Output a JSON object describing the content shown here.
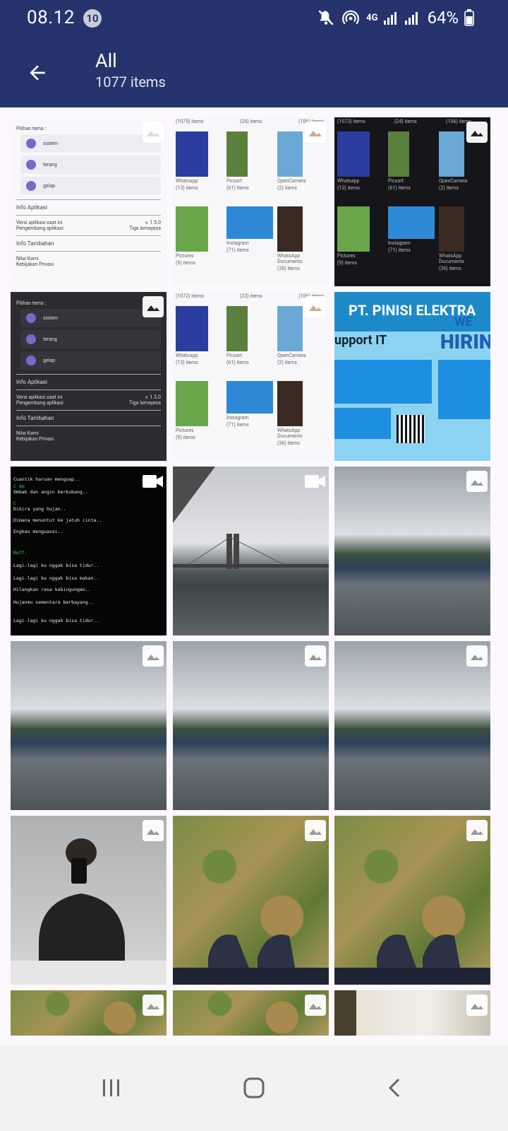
{
  "status_bar": {
    "time": "08.12",
    "notification_count": "10",
    "network": "4G",
    "battery": "64%"
  },
  "app_bar": {
    "title": "All",
    "subtitle": "1077 items"
  },
  "tiles": [
    {
      "type": "screenshot",
      "media": "image-icon"
    },
    {
      "type": "screenshot",
      "media": "image-icon"
    },
    {
      "type": "screenshot",
      "media": "image-icon"
    },
    {
      "type": "screenshot",
      "media": "image-icon"
    },
    {
      "type": "screenshot",
      "media": "image-icon"
    },
    {
      "type": "screenshot",
      "media": "image-icon"
    },
    {
      "type": "video",
      "media": "video-icon"
    },
    {
      "type": "video",
      "media": "video-icon"
    },
    {
      "type": "photo",
      "media": "image-icon"
    },
    {
      "type": "photo",
      "media": "image-icon"
    },
    {
      "type": "photo",
      "media": "image-icon"
    },
    {
      "type": "photo",
      "media": "image-icon"
    },
    {
      "type": "photo",
      "media": "image-icon"
    },
    {
      "type": "photo",
      "media": "image-icon"
    },
    {
      "type": "photo",
      "media": "image-icon"
    },
    {
      "type": "photo",
      "media": "image-icon"
    },
    {
      "type": "photo",
      "media": "image-icon"
    },
    {
      "type": "photo",
      "media": "image-icon"
    }
  ],
  "settings_screen": {
    "theme_heading": "Pilihan tema :",
    "theme_options": [
      "sistem",
      "terang",
      "gelap"
    ],
    "info_app_heading": "Info Aplikasi",
    "version_label": "Versi aplikasi saat ini",
    "version_value": "v. 1.5.0",
    "developer_label": "Pengembang aplikasi",
    "developer_value": "Tiga lamayeza",
    "extra_heading": "Info Tambahan",
    "extra_items": [
      "Nilai Kami",
      "Kebijakan Privasi"
    ]
  },
  "folders_screen_light": {
    "top": [
      "(1075) items",
      "(26) items",
      "(106) items"
    ],
    "folders": [
      {
        "name": "Whatsapp",
        "count": "(13) items"
      },
      {
        "name": "Picsart",
        "count": "(61) items"
      },
      {
        "name": "OpenCamera",
        "count": "(2) items"
      },
      {
        "name": "Pictures",
        "count": "(9) items"
      },
      {
        "name": "Instagram",
        "count": "(71) items"
      },
      {
        "name": "WhatsApp Documents",
        "count": "(36) items"
      }
    ]
  },
  "folders_screen_dark": {
    "top": [
      "(1073) items",
      "(24) items",
      "(106) items"
    ]
  },
  "folders_screen_light2": {
    "top": [
      "(1072) items",
      "(23) items",
      "(106) items"
    ]
  },
  "poster": {
    "company": "PT. PINISI ELEKTRA",
    "we": "WE",
    "hiring": "HIRING",
    "support": "upport IT"
  },
  "terminal_lines": [
    "Cuantik haruan menguap..",
    "Ombak dan angin berkubang..",
    "Dikira yang hujan..",
    "Dimana menuntut ke jatuh cinta..",
    "Engkau menguasai..",
    "Lagi-lagi ku nggak bisa tidur..",
    "Lagi-lagi ku nggak bisa makan..",
    "Hilangkan rasa kebingungan..",
    "Hujanmu sementara berbayang..",
    "Lagi-lagi ku nggak bisa tidur.."
  ]
}
